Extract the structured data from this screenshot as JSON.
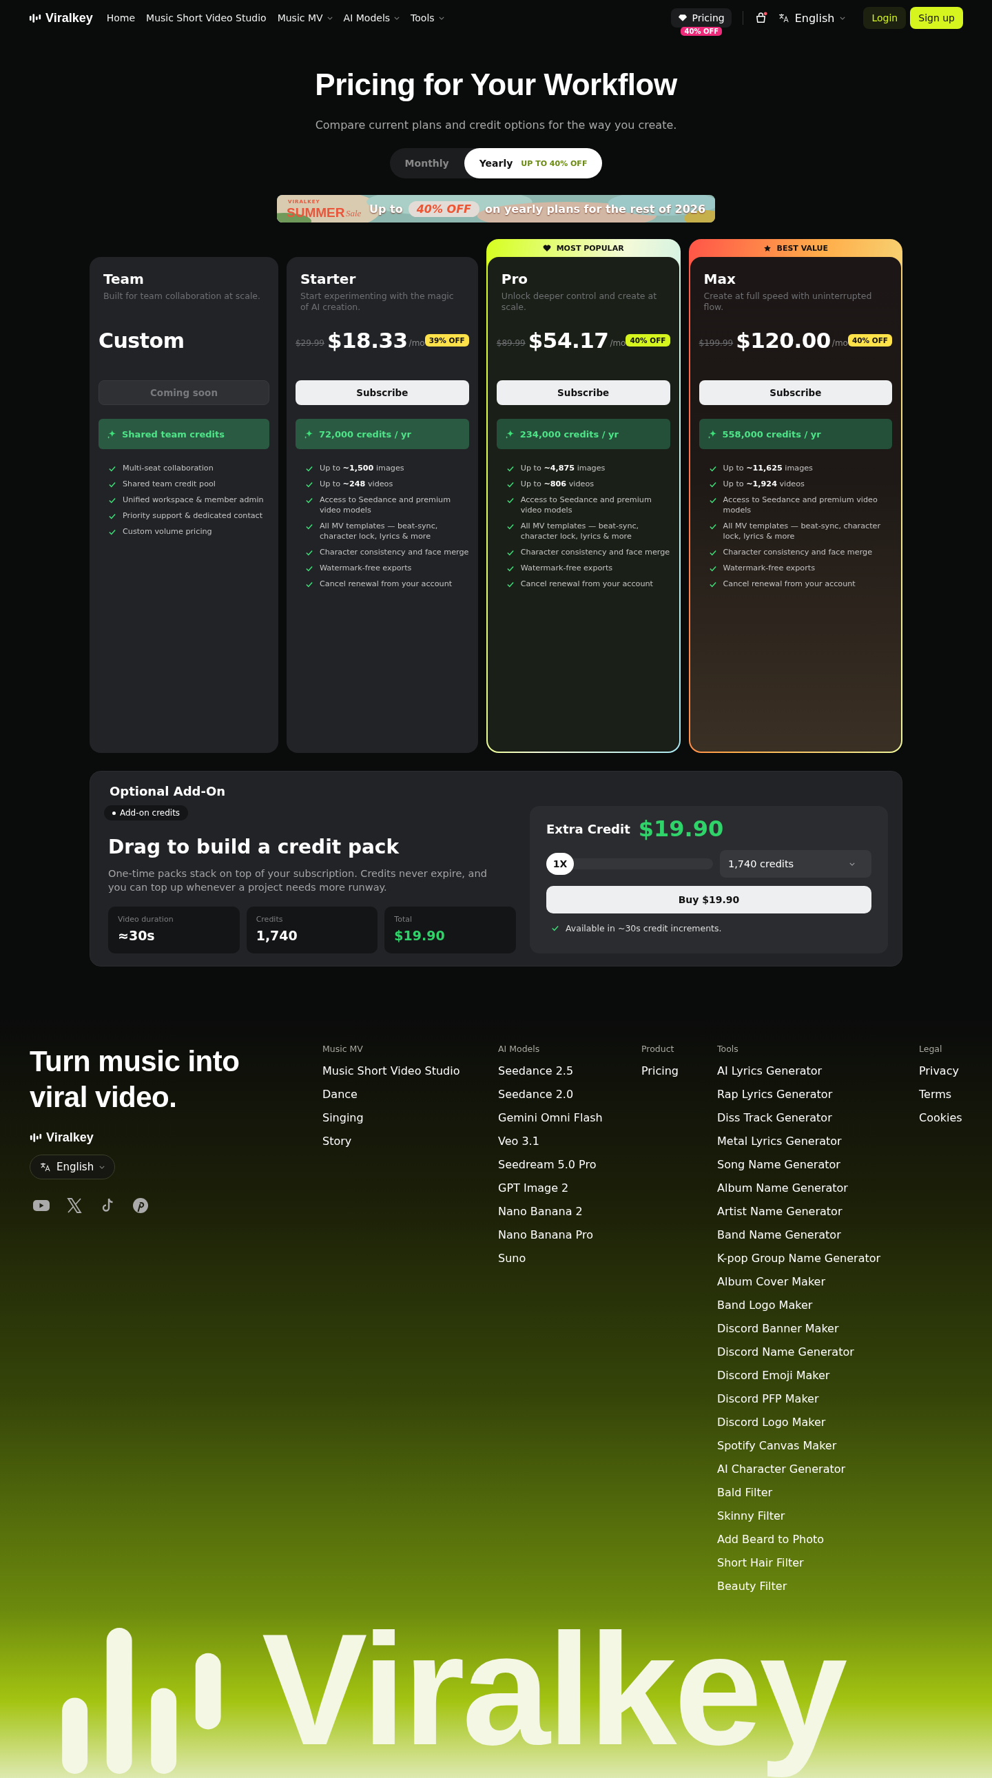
{
  "nav": {
    "brand": "Viralkey",
    "links": [
      {
        "label": "Home",
        "has_menu": false
      },
      {
        "label": "Music Short Video Studio",
        "has_menu": false
      },
      {
        "label": "Music MV",
        "has_menu": true
      },
      {
        "label": "AI Models",
        "has_menu": true
      },
      {
        "label": "Tools",
        "has_menu": true
      }
    ],
    "pricing": {
      "label": "Pricing",
      "badge": "40% OFF"
    },
    "cart_notice": true,
    "language": "English",
    "login": "Login",
    "signup": "Sign up"
  },
  "hero": {
    "title": "Pricing for Your Workflow",
    "subtitle": "Compare current plans and credit options for the way you create.",
    "billing": [
      {
        "label": "Monthly",
        "selected": false
      },
      {
        "label": "Yearly",
        "selected": true,
        "note": "UP TO 40% OFF"
      }
    ],
    "banner": {
      "brand": "VIRALKEY",
      "season": "SUMMER",
      "sale": "Sale",
      "lead": "Up to",
      "offer": "40% OFF",
      "text": "on yearly plans for the rest of 2026"
    }
  },
  "plans": [
    {
      "name": "Team",
      "description": "Built for team collaboration at scale.",
      "price": "Custom",
      "cta": {
        "label": "Coming soon",
        "disabled": true
      },
      "credits": "Shared team credits",
      "features": [
        "Multi-seat collaboration",
        "Shared team credit pool",
        "Unified workspace & member admin",
        "Priority support & dedicated contact",
        "Custom volume pricing"
      ]
    },
    {
      "name": "Starter",
      "description": "Start experimenting with the magic of AI creation.",
      "old_price": "$29.99",
      "price": "$18.33",
      "period": "/mo",
      "discount": {
        "label": "39% OFF",
        "color": "#ffe14a"
      },
      "cta": {
        "label": "Subscribe",
        "disabled": false
      },
      "credits": "72,000 credits / yr",
      "features": [
        "Up to **~1,500** images",
        "Up to **~248** videos",
        "Access to Seedance and premium video models",
        "All MV templates — beat-sync, character lock, lyrics & more",
        "Character consistency and face merge",
        "Watermark-free exports",
        "Cancel renewal from your account"
      ]
    },
    {
      "name": "Pro",
      "ribbon": {
        "kind": "popular",
        "label": "MOST POPULAR"
      },
      "description": "Unlock deeper control and create at scale.",
      "old_price": "$89.99",
      "price": "$54.17",
      "period": "/mo",
      "discount": {
        "label": "40% OFF",
        "color": "#d6f51e"
      },
      "cta": {
        "label": "Subscribe",
        "disabled": false
      },
      "credits": "234,000 credits / yr",
      "features": [
        "Up to **~4,875** images",
        "Up to **~806** videos",
        "Access to Seedance and premium video models",
        "All MV templates — beat-sync, character lock, lyrics & more",
        "Character consistency and face merge",
        "Watermark-free exports",
        "Cancel renewal from your account"
      ]
    },
    {
      "name": "Max",
      "ribbon": {
        "kind": "value",
        "label": "BEST VALUE"
      },
      "description": "Create at full speed with uninterrupted flow.",
      "old_price": "$199.99",
      "price": "$120.00",
      "period": "/mo",
      "discount": {
        "label": "40% OFF",
        "color": "#ffe14a"
      },
      "cta": {
        "label": "Subscribe",
        "disabled": false
      },
      "credits": "558,000 credits / yr",
      "features": [
        "Up to **~11,625** images",
        "Up to **~1,924** videos",
        "Access to Seedance and premium video models",
        "All MV templates — beat-sync, character lock, lyrics & more",
        "Character consistency and face merge",
        "Watermark-free exports",
        "Cancel renewal from your account"
      ]
    }
  ],
  "addon": {
    "heading": "Optional Add-On",
    "tag": "Add-on credits",
    "title": "Drag to build a credit pack",
    "description": "One-time packs stack on top of your subscription. Credits never expire, and you can top up whenever a project needs more runway.",
    "stats": [
      {
        "label": "Video duration",
        "value": "≈30s",
        "accent": false
      },
      {
        "label": "Credits",
        "value": "1,740",
        "accent": false
      },
      {
        "label": "Total",
        "value": "$19.90",
        "accent": true
      }
    ],
    "extra": {
      "label": "Extra Credit",
      "price": "$19.90",
      "multiplier": "1X",
      "level": 0,
      "select": "1,740 credits",
      "buy": "Buy $19.90",
      "note": "Available in ~30s credit increments."
    }
  },
  "footer": {
    "tagline": "Turn music into viral video.",
    "brand": "Viralkey",
    "language": "English",
    "columns": [
      {
        "heading": "Music MV",
        "links": [
          "Music Short Video Studio",
          "Dance",
          "Singing",
          "Story"
        ]
      },
      {
        "heading": "AI Models",
        "links": [
          "Seedance 2.5",
          "Seedance 2.0",
          "Gemini Omni Flash",
          "Veo 3.1",
          "Seedream 5.0 Pro",
          "GPT Image 2",
          "Nano Banana 2",
          "Nano Banana Pro",
          "Suno"
        ]
      },
      {
        "heading": "Product",
        "links": [
          "Pricing"
        ]
      },
      {
        "heading": "Tools",
        "links": [
          "AI Lyrics Generator",
          "Rap Lyrics Generator",
          "Diss Track Generator",
          "Metal Lyrics Generator",
          "Song Name Generator",
          "Album Name Generator",
          "Artist Name Generator",
          "Band Name Generator",
          "K-pop Group Name Generator",
          "Album Cover Maker",
          "Band Logo Maker",
          "Discord Banner Maker",
          "Discord Name Generator",
          "Discord Emoji Maker",
          "Discord PFP Maker",
          "Discord Logo Maker",
          "Spotify Canvas Maker",
          "AI Character Generator",
          "Bald Filter",
          "Skinny Filter",
          "Add Beard to Photo",
          "Short Hair Filter",
          "Beauty Filter"
        ]
      },
      {
        "heading": "Legal",
        "links": [
          "Privacy",
          "Terms",
          "Cookies"
        ]
      }
    ],
    "wordmark": "Viralkey"
  }
}
